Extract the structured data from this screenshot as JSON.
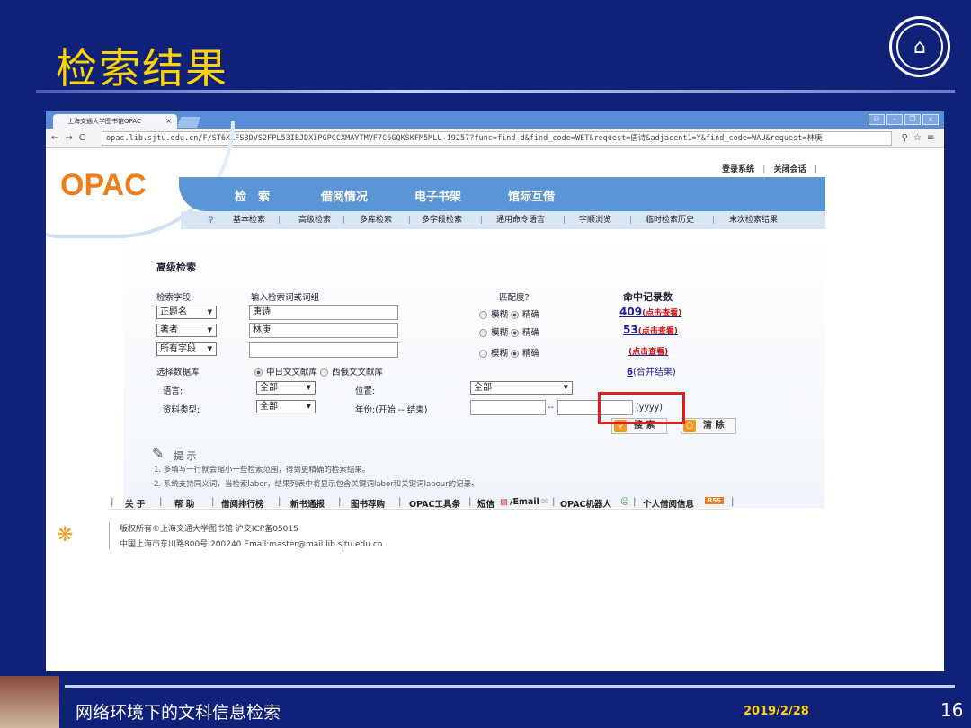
{
  "slide": {
    "title": "检索结果",
    "footer_title": "网络环境下的文科信息检索",
    "footer_date": "2019/2/28",
    "page_number": "16"
  },
  "browser": {
    "tab_title": "上海交通大学图书馆OPAC",
    "tab_close": "×",
    "url": "opac.lib.sjtu.edu.cn/F/ST6XLFS8DVS2FPL53IBJDXIPGPCCXMAYTMVF7C6GQKSKFM5MLU-19257?func=find-d&find_code=WET&request=唐诗&adjacent1=Y&find_code=WAU&request=林庚"
  },
  "opac": {
    "logo": "OPAC",
    "login": "登录系统",
    "close_session": "关闭会话",
    "main_nav": [
      "检　索",
      "借阅情况",
      "电子书架",
      "馆际互借"
    ],
    "sub_nav": [
      "基本检索",
      "高级检索",
      "多库检索",
      "多字段检索",
      "通用命令语言",
      "字顺浏览",
      "临时检索历史",
      "末次检索结果"
    ]
  },
  "form": {
    "heading": "高级检索",
    "col_field": "检索字段",
    "col_input": "输入检索词或词组",
    "col_match": "匹配度?",
    "col_hits": "命中记录数",
    "rows": [
      {
        "field": "正题名",
        "value": "唐诗",
        "fuzzy": "模糊",
        "exact": "精确",
        "hits": "409",
        "hits_note": "(点击查看)"
      },
      {
        "field": "著者",
        "value": "林庚",
        "fuzzy": "模糊",
        "exact": "精确",
        "hits": "53",
        "hits_note": "(点击查看)"
      },
      {
        "field": "所有字段",
        "value": "",
        "fuzzy": "模糊",
        "exact": "精确",
        "hits": "",
        "hits_note": "(点击查看)"
      }
    ],
    "db_label": "选择数据库",
    "db_cn": "中日文文献库",
    "db_west": "西俄文文献库",
    "merge_count": "6",
    "merge_label": "(合并结果)",
    "lang_label": "语言:",
    "lang_value": "全部",
    "location_label": "位置:",
    "location_value": "全部",
    "type_label": "资料类型:",
    "type_value": "全部",
    "year_label": "年份:(开始 -- 结束)",
    "year_sep": "--",
    "year_hint": "(yyyy)",
    "search_btn": "搜 索",
    "clear_btn": "清 除"
  },
  "tips": {
    "title": "提 示",
    "lines": [
      "1. 多填写一行就会缩小一些检索范围，得到更精确的检索结果。",
      "2. 系统支持同义词，当检索labor，结果列表中将显示包含关键词labor和关键词labour的记录。"
    ]
  },
  "footer_nav": [
    "关 于",
    "帮 助",
    "借阅排行榜",
    "新书通报",
    "图书荐购",
    "OPAC工具条",
    "短信",
    "/Email",
    "OPAC机器人",
    "个人借阅信息",
    "RSS"
  ],
  "copyright": {
    "line1": "版权所有©上海交通大学图书馆  沪交ICP备05015",
    "line2": "中国上海市东川路800号 200240  Email:master@mail.lib.sjtu.edu.cn"
  },
  "colors": {
    "slide_bg": "#10217a",
    "title": "#ffd400",
    "opac_orange": "#ef7d1a",
    "nav_blue": "#5a95d6",
    "highlight_red": "#e02020"
  }
}
